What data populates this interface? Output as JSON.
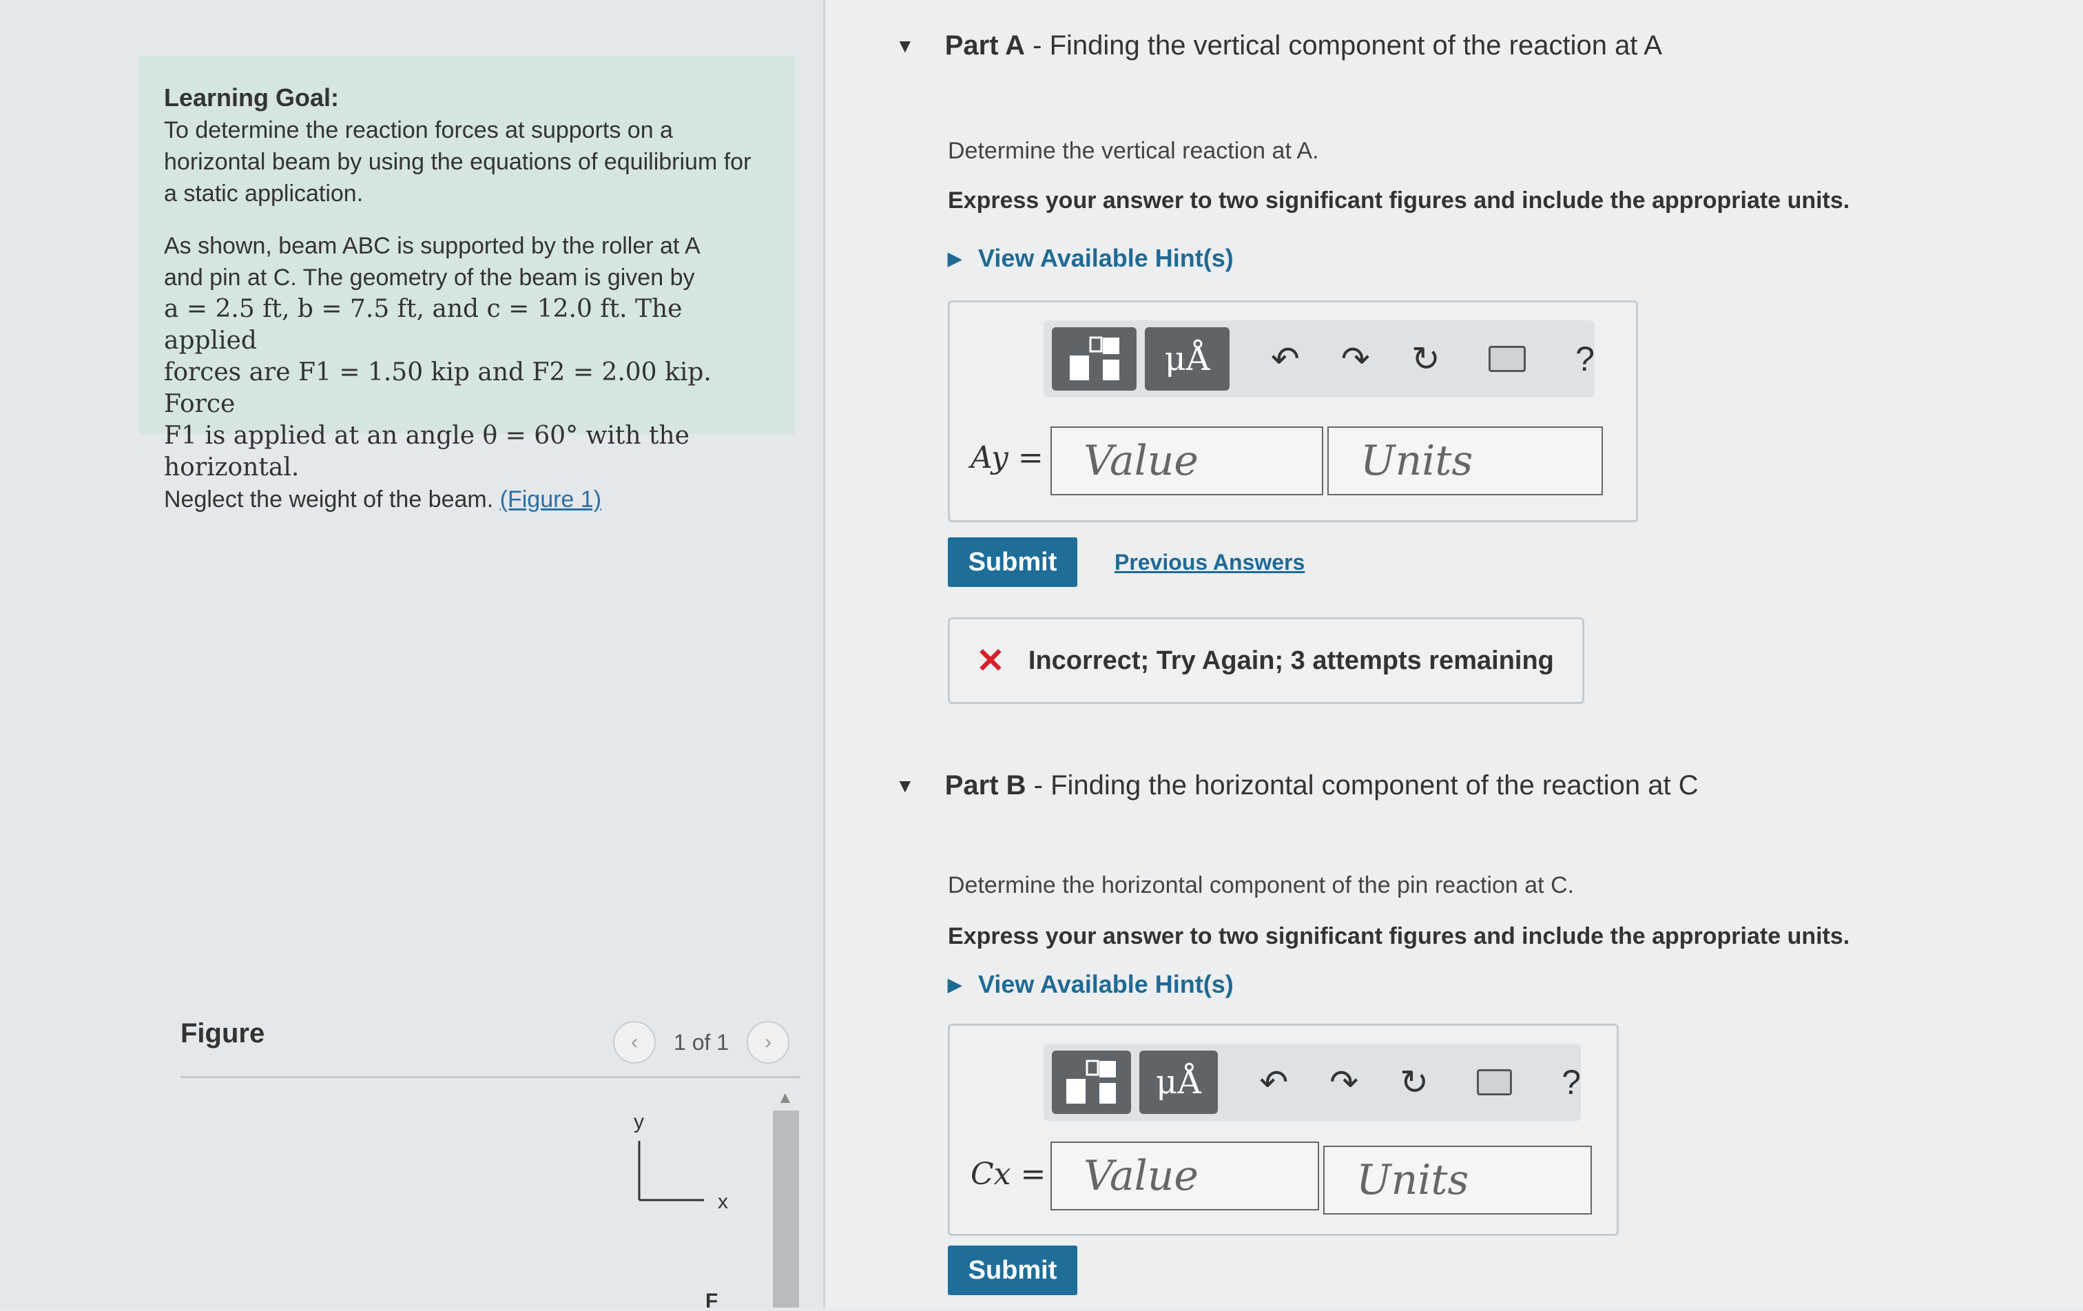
{
  "left": {
    "goal_heading": "Learning Goal:",
    "goal_text": "To determine the reaction forces at supports on a horizontal beam by using the equations of equilibrium for a static application.",
    "desc_line1": "As shown, beam ABC is supported by the roller at A",
    "desc_line2": "and pin at C. The geometry of the beam is given by",
    "desc_line3": "a = 2.5 ft, b = 7.5 ft, and c = 12.0 ft. The applied",
    "desc_line4": "forces are F1 = 1.50 kip and F2 = 2.00 kip. Force",
    "desc_line5": "F1 is applied at an angle θ = 60° with the horizontal.",
    "desc_line6": "Neglect the weight of the beam.",
    "figure_link": "(Figure 1)",
    "figure_label": "Figure",
    "pager_text": "1 of 1",
    "axis_y": "y",
    "axis_x": "x",
    "fig_partial": "F"
  },
  "partA": {
    "title_bold": "Part A",
    "title_rest": " - Finding the vertical component of the reaction at A",
    "question": "Determine the vertical reaction at A.",
    "instruction": "Express your answer to two significant figures and include the appropriate units.",
    "hint": "View Available Hint(s)",
    "var_label": "Ay =",
    "value_placeholder": "Value",
    "units_placeholder": "Units",
    "submit": "Submit",
    "previous_answers": "Previous Answers",
    "feedback": "Incorrect; Try Again; 3 attempts remaining"
  },
  "partB": {
    "title_bold": "Part B",
    "title_rest": " - Finding the horizontal component of the reaction at C",
    "question": "Determine the horizontal component of the pin reaction at C.",
    "instruction": "Express your answer to two significant figures and include the appropriate units.",
    "hint": "View Available Hint(s)",
    "var_label": "Cx =",
    "value_placeholder": "Value",
    "units_placeholder": "Units",
    "submit": "Submit"
  },
  "toolbar": {
    "units_btn": "μÅ",
    "help": "?"
  },
  "icons": [
    "templates-icon",
    "units-icon",
    "undo-icon",
    "redo-icon",
    "reset-icon",
    "keyboard-icon",
    "help-icon",
    "collapse-triangle-icon",
    "hint-arrow-icon",
    "incorrect-x-icon",
    "chevron-left-icon",
    "chevron-right-icon"
  ],
  "colors": {
    "accent": "#1e6e99",
    "error": "#d6212b",
    "goal_bg": "#d5e5e1"
  }
}
